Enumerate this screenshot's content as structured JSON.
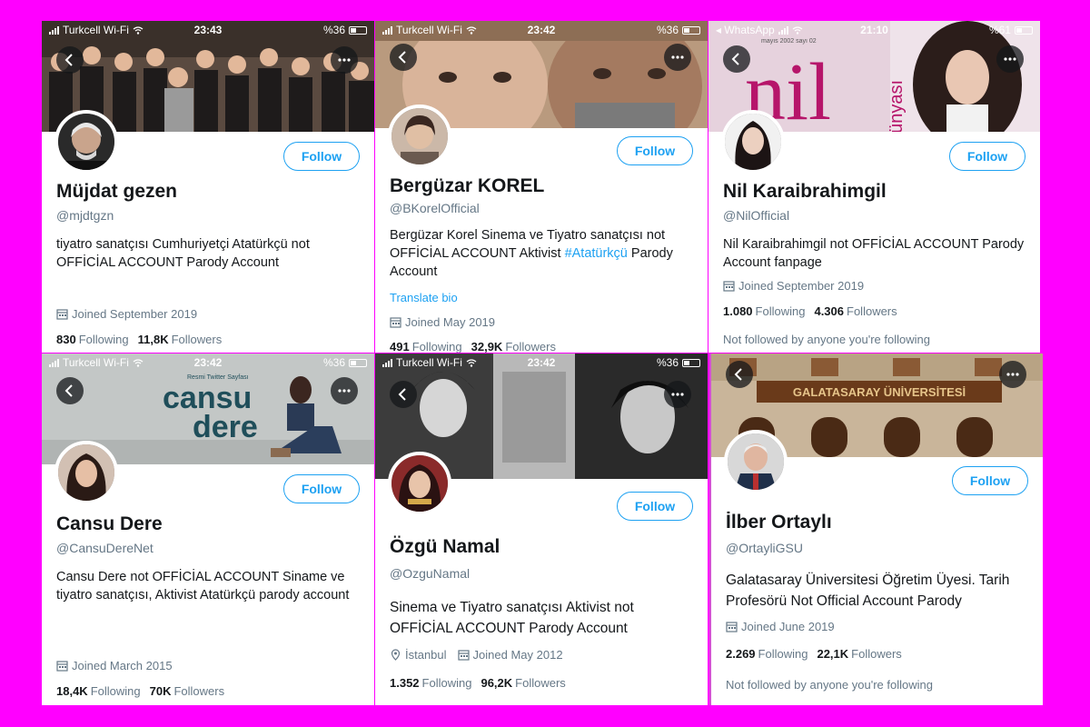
{
  "profiles": [
    {
      "status": {
        "carrier": "Turkcell Wi-Fi",
        "time": "23:43",
        "battery": "%36"
      },
      "name": "Müjdat gezen",
      "handle": "@mjdtgzn",
      "bio": "tiyatro sanatçısı Cumhuriyetçi Atatürkçü not OFFİCİAL ACCOUNT Parody Account",
      "joined": "Joined September 2019",
      "following": "830",
      "followers": "11,8K",
      "follow_label": "Follow"
    },
    {
      "status": {
        "carrier": "Turkcell Wi-Fi",
        "time": "23:42",
        "battery": "%36"
      },
      "name": "Bergüzar KOREL",
      "handle": "@BKorelOfficial",
      "bio_before": "Bergüzar Korel Sinema ve Tiyatro sanatçısı not OFFİCİAL ACCOUNT Aktivist ",
      "bio_hashtag": "#Atatürkçü",
      "bio_after": " Parody Account",
      "translate": "Translate bio",
      "joined": "Joined May 2019",
      "following": "491",
      "followers": "32,9K",
      "follow_label": "Follow"
    },
    {
      "status": {
        "carrier": "WhatsApp",
        "time": "21:10",
        "battery": "%61"
      },
      "banner_text": {
        "brand_a": "nil",
        "brand_b": "dünyası",
        "issue": "mayıs 2002 sayı 02"
      },
      "name": "Nil Karaibrahimgil",
      "handle": "@NilOfficial",
      "bio": "Nil Karaibrahimgil not OFFİCİAL ACCOUNT Parody Account fanpage",
      "joined": "Joined September 2019",
      "following": "1.080",
      "followers": "4.306",
      "note": "Not followed by anyone you're following",
      "follow_label": "Follow"
    },
    {
      "status": {
        "carrier": "Turkcell Wi-Fi",
        "time": "23:42",
        "battery": "%36"
      },
      "banner_text": {
        "line1": "cansu",
        "line2": "dere",
        "small": "Resmi Twitter Sayfası"
      },
      "name": "Cansu Dere",
      "handle": "@CansuDereNet",
      "bio": "Cansu Dere not OFFİCİAL ACCOUNT Siname ve tiyatro sanatçısı, Aktivist Atatürkçü parody account",
      "joined": "Joined March 2015",
      "following": "18,4K",
      "followers": "70K",
      "follow_label": "Follow"
    },
    {
      "status": {
        "carrier": "Turkcell Wi-Fi",
        "time": "23:42",
        "battery": "%36"
      },
      "name": "Özgü Namal",
      "handle": "@OzguNamal",
      "bio": "Sinema ve Tiyatro sanatçısı Aktivist not OFFİCİAL ACCOUNT Parody Account",
      "location": "İstanbul",
      "joined": "Joined May 2012",
      "following": "1.352",
      "followers": "96,2K",
      "follow_label": "Follow"
    },
    {
      "banner_text": {
        "sign": "GALATASARAY ÜNİVERSİTESİ"
      },
      "name": "İlber Ortaylı",
      "handle": "@OrtayliGSU",
      "bio": "Galatasaray Üniversitesi Öğretim Üyesi. Tarih Profesörü Not Official Account Parody",
      "joined": "Joined June 2019",
      "following": "2.269",
      "followers": "22,1K",
      "note": "Not followed by anyone you're following",
      "follow_label": "Follow"
    }
  ],
  "labels": {
    "following": "Following",
    "followers": "Followers"
  },
  "colors": {
    "background": "#ff00ff",
    "accent": "#1da1f2",
    "muted": "#657786",
    "text": "#14171a"
  }
}
